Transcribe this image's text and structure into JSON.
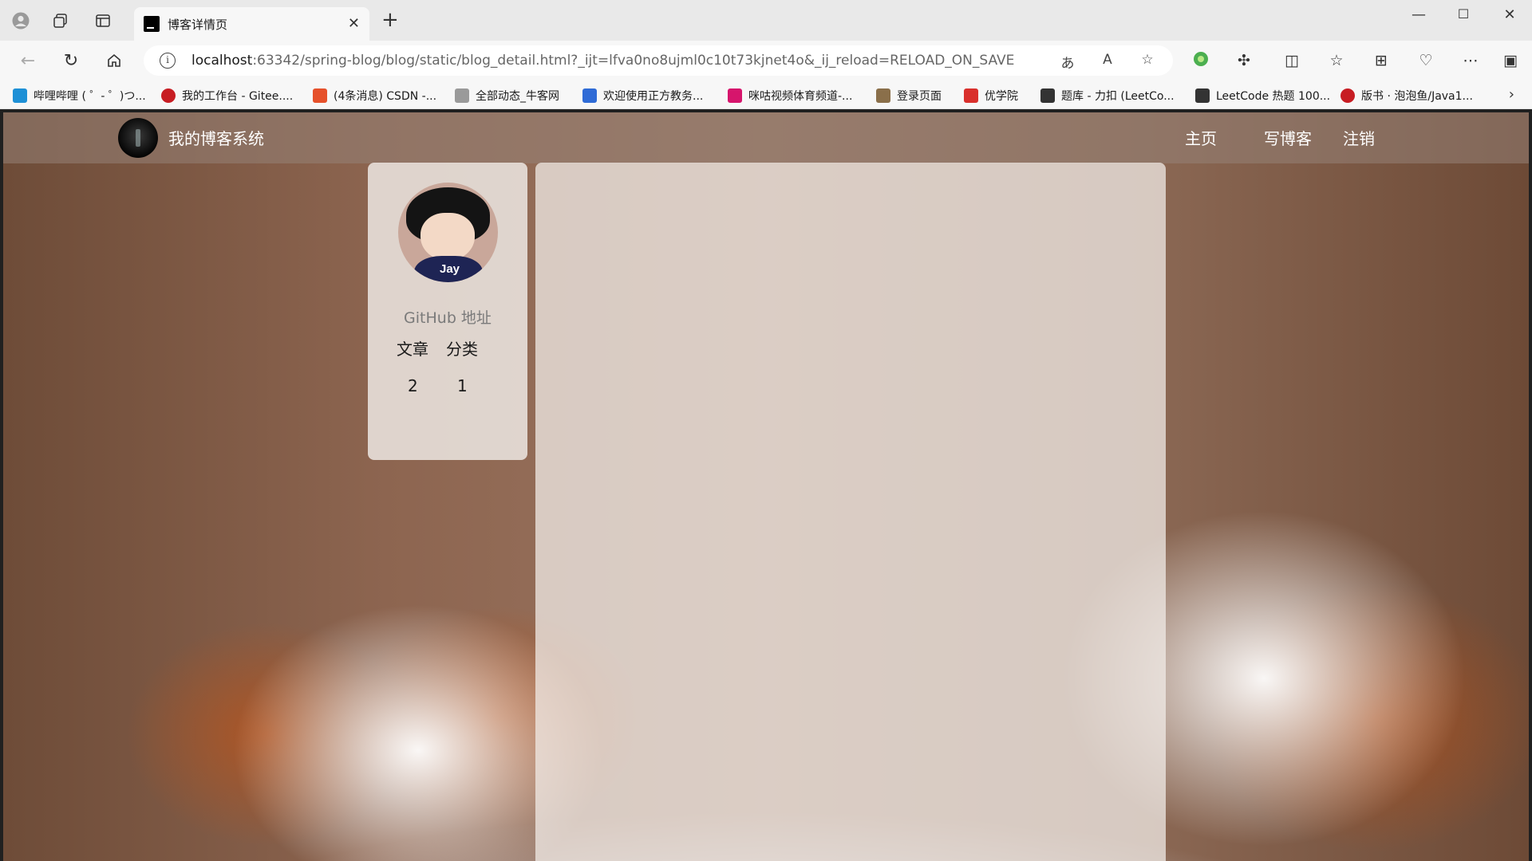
{
  "browser": {
    "tab": {
      "title": "博客详情页"
    },
    "address": {
      "host": "localhost",
      "rest": ":63342/spring-blog/blog/static/blog_detail.html?_ijt=lfva0no8ujml0c10t73kjnet4o&_ij_reload=RELOAD_ON_SAVE"
    },
    "bookmarks": [
      {
        "label": "哔哩哔哩 ( ゜- ゜)つ...",
        "color": "#1e90d6"
      },
      {
        "label": "我的工作台 - Gitee....",
        "color": "#c71d23"
      },
      {
        "label": "(4条消息) CSDN -...",
        "color": "#e6512b"
      },
      {
        "label": "全部动态_牛客网",
        "color": "#9a9a9a"
      },
      {
        "label": "欢迎使用正方教务...",
        "color": "#2f6bd6"
      },
      {
        "label": "咪咕视频体育频道-...",
        "color": "#d6156c"
      },
      {
        "label": "登录页面",
        "color": "#8a6f4a"
      },
      {
        "label": "优学院",
        "color": "#d9302c"
      },
      {
        "label": "题库 - 力扣 (LeetCo...",
        "color": "#333333"
      },
      {
        "label": "LeetCode 热题 100...",
        "color": "#333333"
      },
      {
        "label": "版书 · 泡泡鱼/Java1...",
        "color": "#c71d23"
      }
    ]
  },
  "site": {
    "title": "我的博客系统",
    "nav": {
      "home": "主页",
      "write": "写博客",
      "logout": "注销"
    }
  },
  "profile": {
    "avatar_text": "Jay",
    "github": "GitHub 地址",
    "stats": {
      "articles_label": "文章",
      "categories_label": "分类",
      "articles": "2",
      "categories": "1"
    }
  }
}
